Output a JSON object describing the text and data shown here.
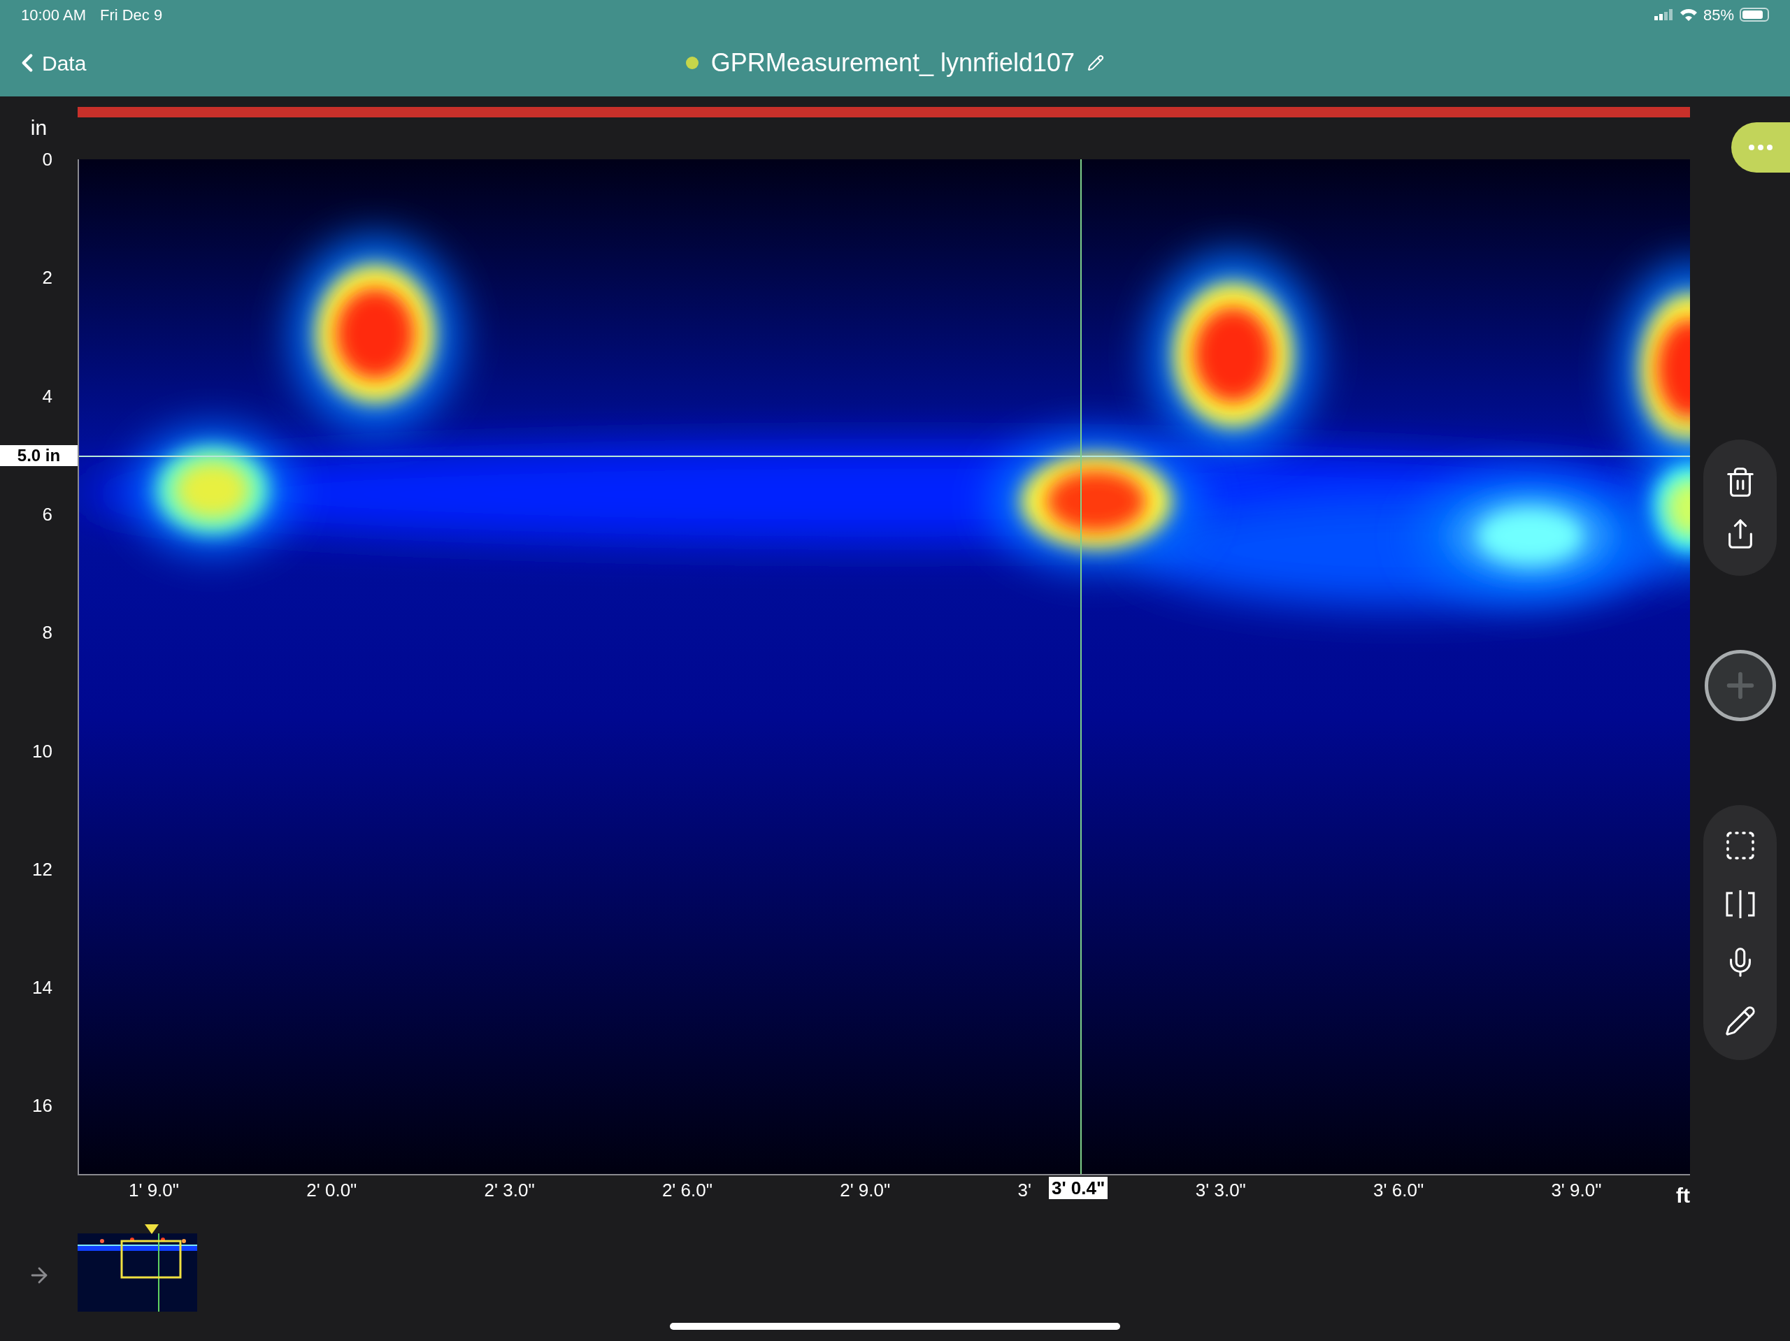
{
  "status_bar": {
    "time": "10:00 AM",
    "date": "Fri Dec 9",
    "battery": "85%"
  },
  "nav_bar": {
    "back": "Data",
    "title": "GPRMeasurement_ lynnfield107"
  },
  "y_axis": {
    "unit": "in",
    "ticks": [
      "0",
      "2",
      "4",
      "6",
      "8",
      "10",
      "12",
      "14",
      "16"
    ],
    "cursor_readout": "5.0 in"
  },
  "x_axis": {
    "unit": "ft",
    "ticks": [
      "1' 9.0\"",
      "2' 0.0\"",
      "2' 3.0\"",
      "2' 6.0\"",
      "2' 9.0\"",
      "3'",
      "3' 3.0\"",
      "3' 6.0\"",
      "3' 9.0\""
    ],
    "cursor_readout": "3' 0.4\""
  }
}
